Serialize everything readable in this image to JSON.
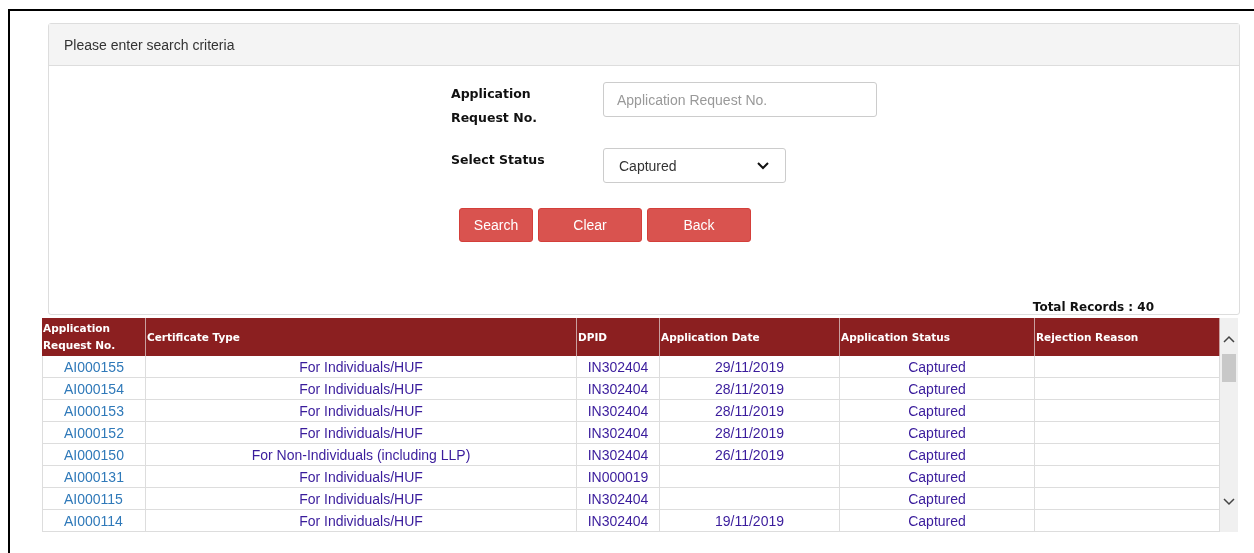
{
  "panel": {
    "title": "Please enter search criteria"
  },
  "form": {
    "request_no": {
      "label": "Application Request No.",
      "placeholder": "Application Request No."
    },
    "status": {
      "label": "Select Status",
      "value": "Captured"
    }
  },
  "buttons": [
    "Search",
    "Clear",
    "Back"
  ],
  "total_records": "Total Records : 40",
  "table": {
    "columns": [
      "Application Request No.",
      "Certificate Type",
      "DPID",
      "Application Date",
      "Application Status",
      "Rejection Reason"
    ],
    "rows": [
      [
        "AI000155",
        "For Individuals/HUF",
        "IN302404",
        "29/11/2019",
        "Captured",
        ""
      ],
      [
        "AI000154",
        "For Individuals/HUF",
        "IN302404",
        "28/11/2019",
        "Captured",
        ""
      ],
      [
        "AI000153",
        "For Individuals/HUF",
        "IN302404",
        "28/11/2019",
        "Captured",
        ""
      ],
      [
        "AI000152",
        "For Individuals/HUF",
        "IN302404",
        "28/11/2019",
        "Captured",
        ""
      ],
      [
        "AI000150",
        "For Non-Individuals (including LLP)",
        "IN302404",
        "26/11/2019",
        "Captured",
        ""
      ],
      [
        "AI000131",
        "For Individuals/HUF",
        "IN000019",
        "",
        "Captured",
        ""
      ],
      [
        "AI000115",
        "For Individuals/HUF",
        "IN302404",
        "",
        "Captured",
        ""
      ],
      [
        "AI000114",
        "For Individuals/HUF",
        "IN302404",
        "19/11/2019",
        "Captured",
        ""
      ]
    ]
  }
}
